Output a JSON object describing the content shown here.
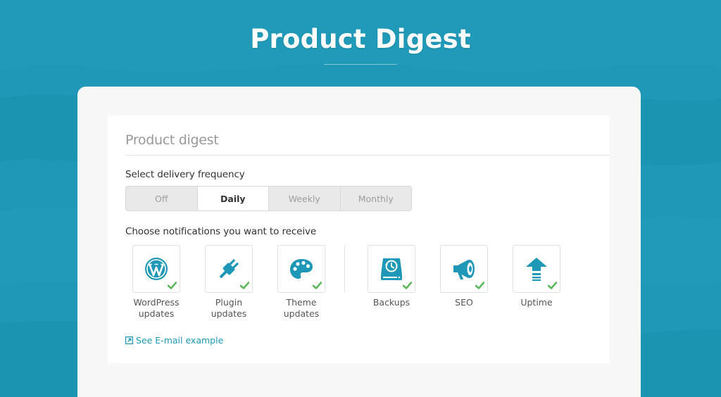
{
  "page": {
    "title": "Product Digest"
  },
  "panel": {
    "title": "Product digest",
    "frequency_label": "Select delivery frequency",
    "frequency_options": [
      "Off",
      "Daily",
      "Weekly",
      "Monthly"
    ],
    "frequency_selected": "Daily",
    "notifications_label": "Choose notifications you want to receive",
    "notifications": [
      {
        "icon": "wordpress-icon",
        "line1": "WordPress",
        "line2": "updates",
        "checked": true
      },
      {
        "icon": "plug-icon",
        "line1": "Plugin",
        "line2": "updates",
        "checked": true
      },
      {
        "icon": "palette-icon",
        "line1": "Theme",
        "line2": "updates",
        "checked": true
      },
      {
        "icon": "backup-drive-icon",
        "line1": "Backups",
        "line2": "",
        "checked": true
      },
      {
        "icon": "megaphone-icon",
        "line1": "SEO",
        "line2": "",
        "checked": true
      },
      {
        "icon": "upload-arrow-icon",
        "line1": "Uptime",
        "line2": "",
        "checked": true
      }
    ],
    "email_link": "See E-mail example"
  },
  "colors": {
    "background": "#1e98b6",
    "accent": "#1e98b6",
    "check": "#5cb85c",
    "card": "#f7f7f7",
    "panel": "#ffffff"
  }
}
